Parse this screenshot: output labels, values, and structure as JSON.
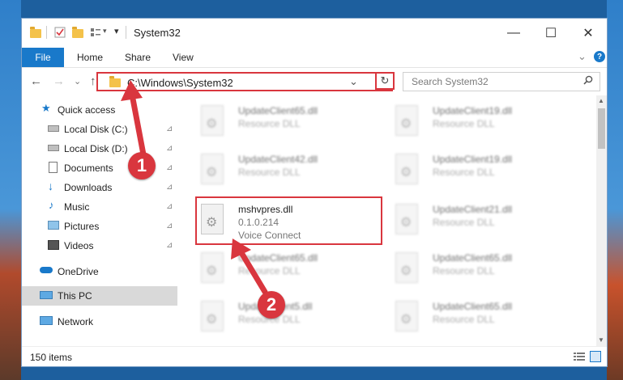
{
  "window": {
    "title": "System32",
    "minimize_glyph": "—",
    "maximize_glyph": "☐",
    "close_glyph": "✕"
  },
  "ribbon": {
    "tabs": [
      {
        "label": "File"
      },
      {
        "label": "Home"
      },
      {
        "label": "Share"
      },
      {
        "label": "View"
      }
    ],
    "help_glyph": "?",
    "expand_glyph": "⌄"
  },
  "address": {
    "path": "C:\\Windows\\System32",
    "dropdown_glyph": "⌄",
    "refresh_glyph": "↻",
    "search_placeholder": "Search System32",
    "back_glyph": "←",
    "forward_glyph": "→",
    "recent_glyph": "⌄",
    "up_glyph": "↑"
  },
  "sidebar": {
    "items": [
      {
        "label": "Quick access",
        "icon": "star-icon"
      },
      {
        "label": "Local Disk (C:)",
        "icon": "drive-icon"
      },
      {
        "label": "Local Disk (D:)",
        "icon": "drive-icon"
      },
      {
        "label": "Documents",
        "icon": "documents-icon"
      },
      {
        "label": "Downloads",
        "icon": "download-icon"
      },
      {
        "label": "Music",
        "icon": "music-icon"
      },
      {
        "label": "Pictures",
        "icon": "pictures-icon"
      },
      {
        "label": "Videos",
        "icon": "videos-icon"
      },
      {
        "label": "OneDrive",
        "icon": "cloud-icon"
      },
      {
        "label": "This PC",
        "icon": "computer-icon"
      },
      {
        "label": "Network",
        "icon": "network-icon"
      }
    ],
    "pin_glyph": "📌"
  },
  "files": {
    "left": [
      {
        "name": "UpdateClient65.dll",
        "desc": "Resource DLL"
      },
      {
        "name": "UpdateClient42.dll",
        "desc": "Resource DLL"
      },
      {
        "name": "UpdateClient65.dll",
        "desc": "Resource DLL"
      },
      {
        "name": "UpdateClient5.dll",
        "desc": "Resource DLL"
      }
    ],
    "right": [
      {
        "name": "UpdateClient19.dll",
        "desc": "Resource DLL"
      },
      {
        "name": "UpdateClient19.dll",
        "desc": "Resource DLL"
      },
      {
        "name": "UpdateClient21.dll",
        "desc": "Resource DLL"
      },
      {
        "name": "UpdateClient65.dll",
        "desc": "Resource DLL"
      },
      {
        "name": "UpdateClient65.dll",
        "desc": "Resource DLL"
      }
    ],
    "highlighted": {
      "name": "mshvpres.dll",
      "version": "0.1.0.214",
      "desc": "Voice Connect"
    }
  },
  "annotations": {
    "badge1": "1",
    "badge2": "2",
    "color": "#d9363e"
  },
  "status": {
    "item_count": "150 items"
  }
}
